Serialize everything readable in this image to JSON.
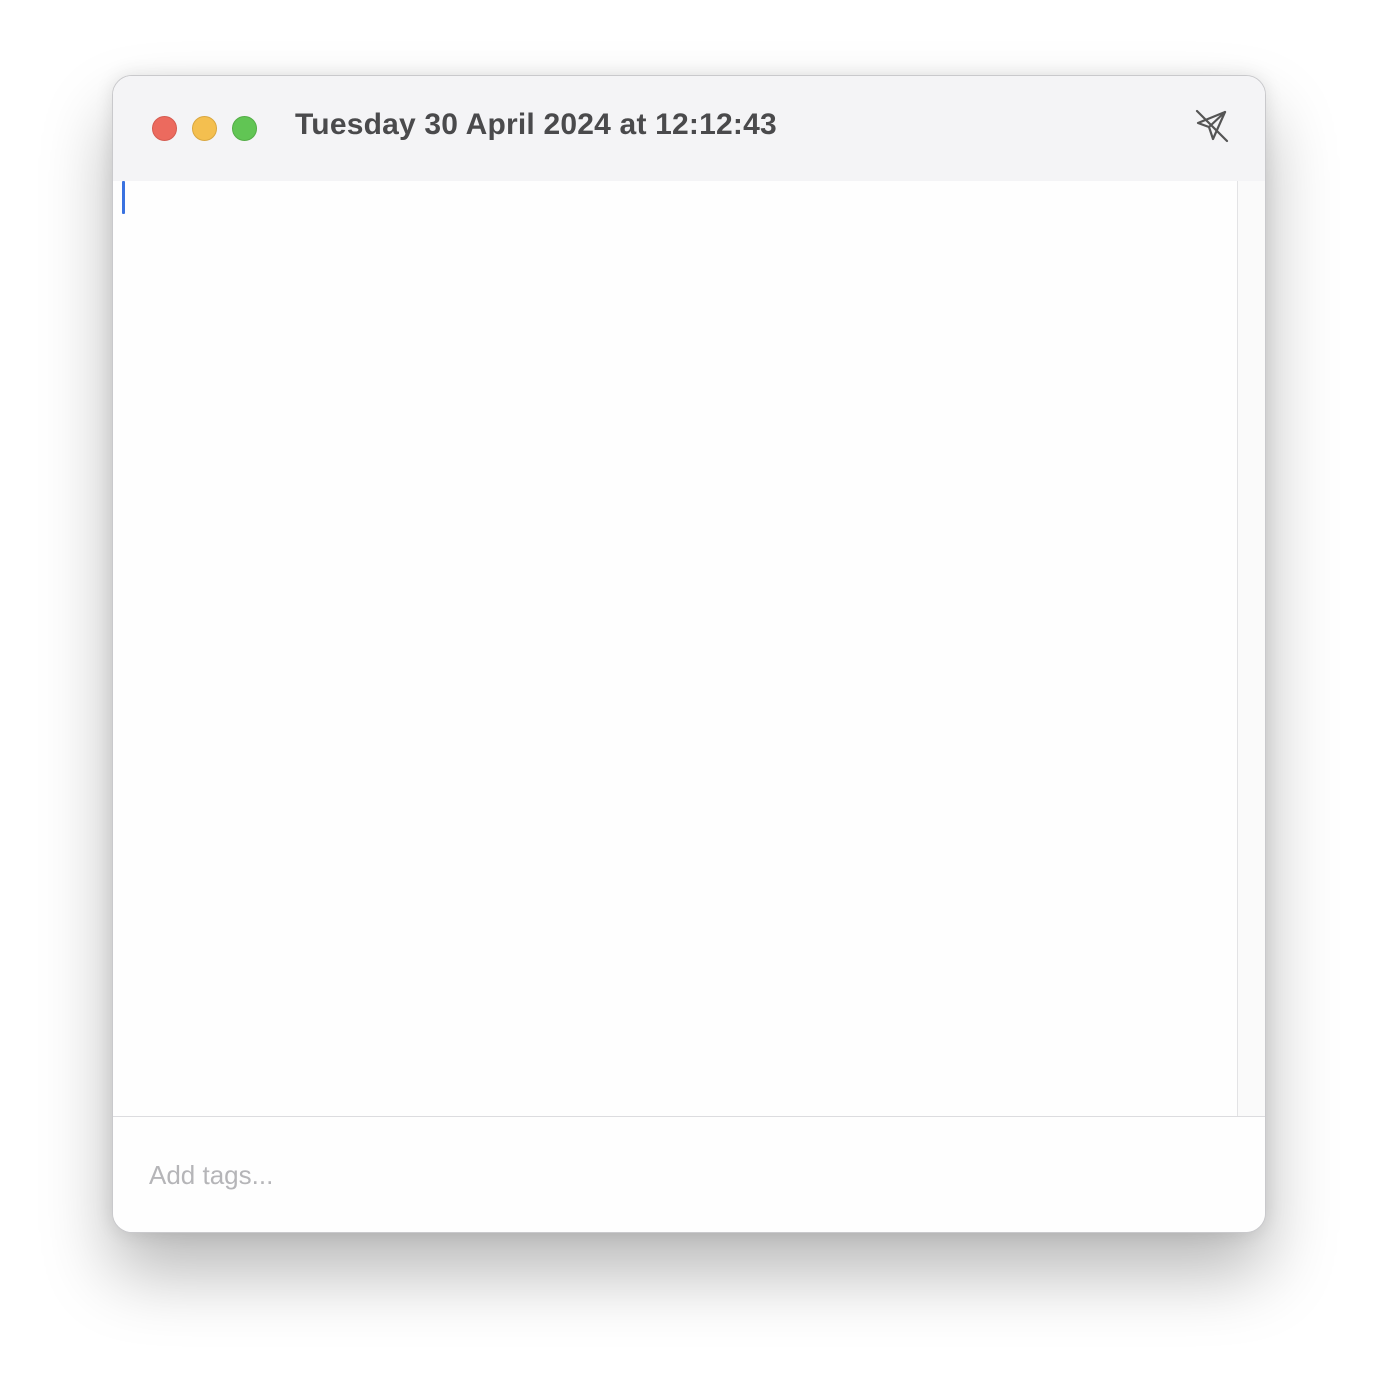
{
  "window": {
    "title": "Tuesday 30 April 2024 at 12:12:43"
  },
  "titlebar": {
    "close_icon": "traffic-light-close",
    "minimize_icon": "traffic-light-minimize",
    "zoom_icon": "traffic-light-zoom",
    "pin_icon": "pin-slash-icon"
  },
  "editor": {
    "content": ""
  },
  "tags": {
    "placeholder": "Add tags..."
  },
  "colors": {
    "close": "#ec6a5e",
    "minimize": "#f4bf4f",
    "zoom": "#61c554",
    "caret": "#3a72e0"
  }
}
